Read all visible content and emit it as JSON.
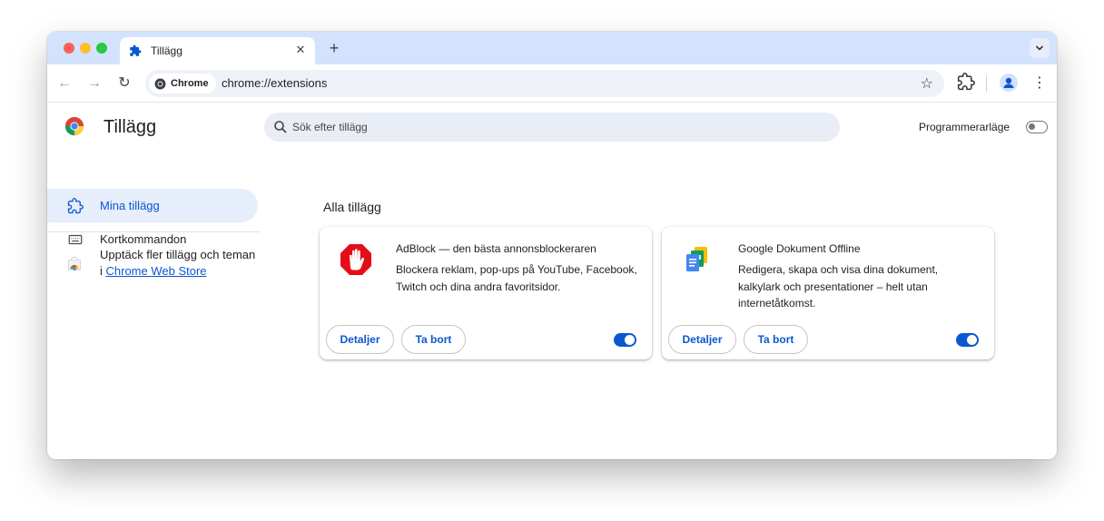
{
  "tab": {
    "title": "Tillägg",
    "close_glyph": "✕"
  },
  "new_tab_glyph": "+",
  "tab_menu_glyph": "⌄",
  "toolbar": {
    "back_glyph": "←",
    "forward_glyph": "→",
    "reload_glyph": "↻",
    "chip_label": "Chrome",
    "url": "chrome://extensions",
    "star_glyph": "☆",
    "menu_glyph": "⋮"
  },
  "page": {
    "title": "Tillägg",
    "search_placeholder": "Sök efter tillägg",
    "developer_mode_label": "Programmerarläge",
    "developer_mode_on": false
  },
  "sidebar": {
    "items": [
      {
        "label": "Mina tillägg",
        "icon": "puzzle-icon",
        "active": true
      },
      {
        "label": "Kortkommandon",
        "icon": "keyboard-icon",
        "active": false
      }
    ],
    "discover_text": "Upptäck fler tillägg och teman i ",
    "discover_link": "Chrome Web Store"
  },
  "section_title": "Alla tillägg",
  "extensions": [
    {
      "name": "AdBlock — den bästa annonsblockeraren",
      "description": "Blockera reklam, pop-ups på YouTube, Facebook, Twitch och dina andra favoritsidor.",
      "icon": "adblock-stop-hand-icon",
      "details_label": "Detaljer",
      "remove_label": "Ta bort",
      "enabled": true
    },
    {
      "name": "Google Dokument Offline",
      "description": "Redigera, skapa och visa dina dokument, kalkylark och presentationer – helt utan internetåtkomst.",
      "icon": "google-docs-offline-icon",
      "details_label": "Detaljer",
      "remove_label": "Ta bort",
      "enabled": true
    }
  ],
  "colors": {
    "accent": "#0b57d0",
    "tabstrip": "#d3e3fd",
    "active_nav_bg": "#e6edfb",
    "adblock_red": "#e40d17"
  }
}
